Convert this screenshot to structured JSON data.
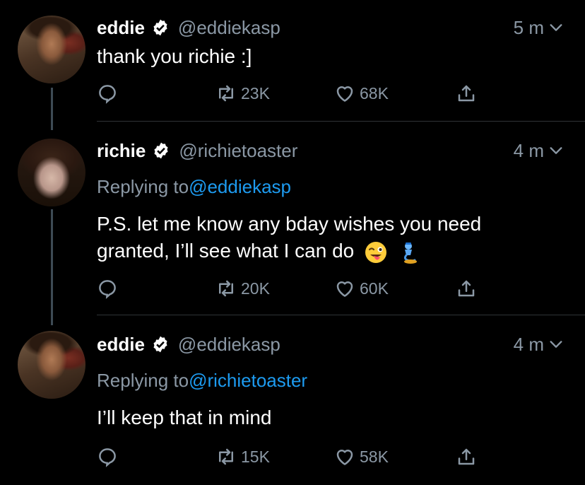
{
  "tweets": [
    {
      "name": "eddie",
      "handle": "@eddiekasp",
      "time": "5 m",
      "replying_label": "",
      "replying_to": "",
      "text": "thank you richie :]",
      "retweets": "23K",
      "likes": "68K",
      "avatar": "eddie"
    },
    {
      "name": "richie",
      "handle": "@richietoaster",
      "time": "4 m",
      "replying_label": "Replying to",
      "replying_to": "@eddiekasp",
      "text_line1": "P.S. let me know any bday wishes you need",
      "text_line2": "granted, I’ll see what I can do",
      "emojis": [
        "winking-face-with-tongue-emoji",
        "genie-emoji"
      ],
      "retweets": "20K",
      "likes": "60K",
      "avatar": "richie"
    },
    {
      "name": "eddie",
      "handle": "@eddiekasp",
      "time": "4 m",
      "replying_label": "Replying to",
      "replying_to": "@richietoaster",
      "text": "I’ll keep that in mind",
      "retweets": "15K",
      "likes": "58K",
      "avatar": "eddie"
    }
  ],
  "colors": {
    "background": "#000000",
    "secondary_text": "#8b98a5",
    "link": "#1d9bf0",
    "divider": "#2f3336",
    "thread_line": "#3d4a54"
  }
}
